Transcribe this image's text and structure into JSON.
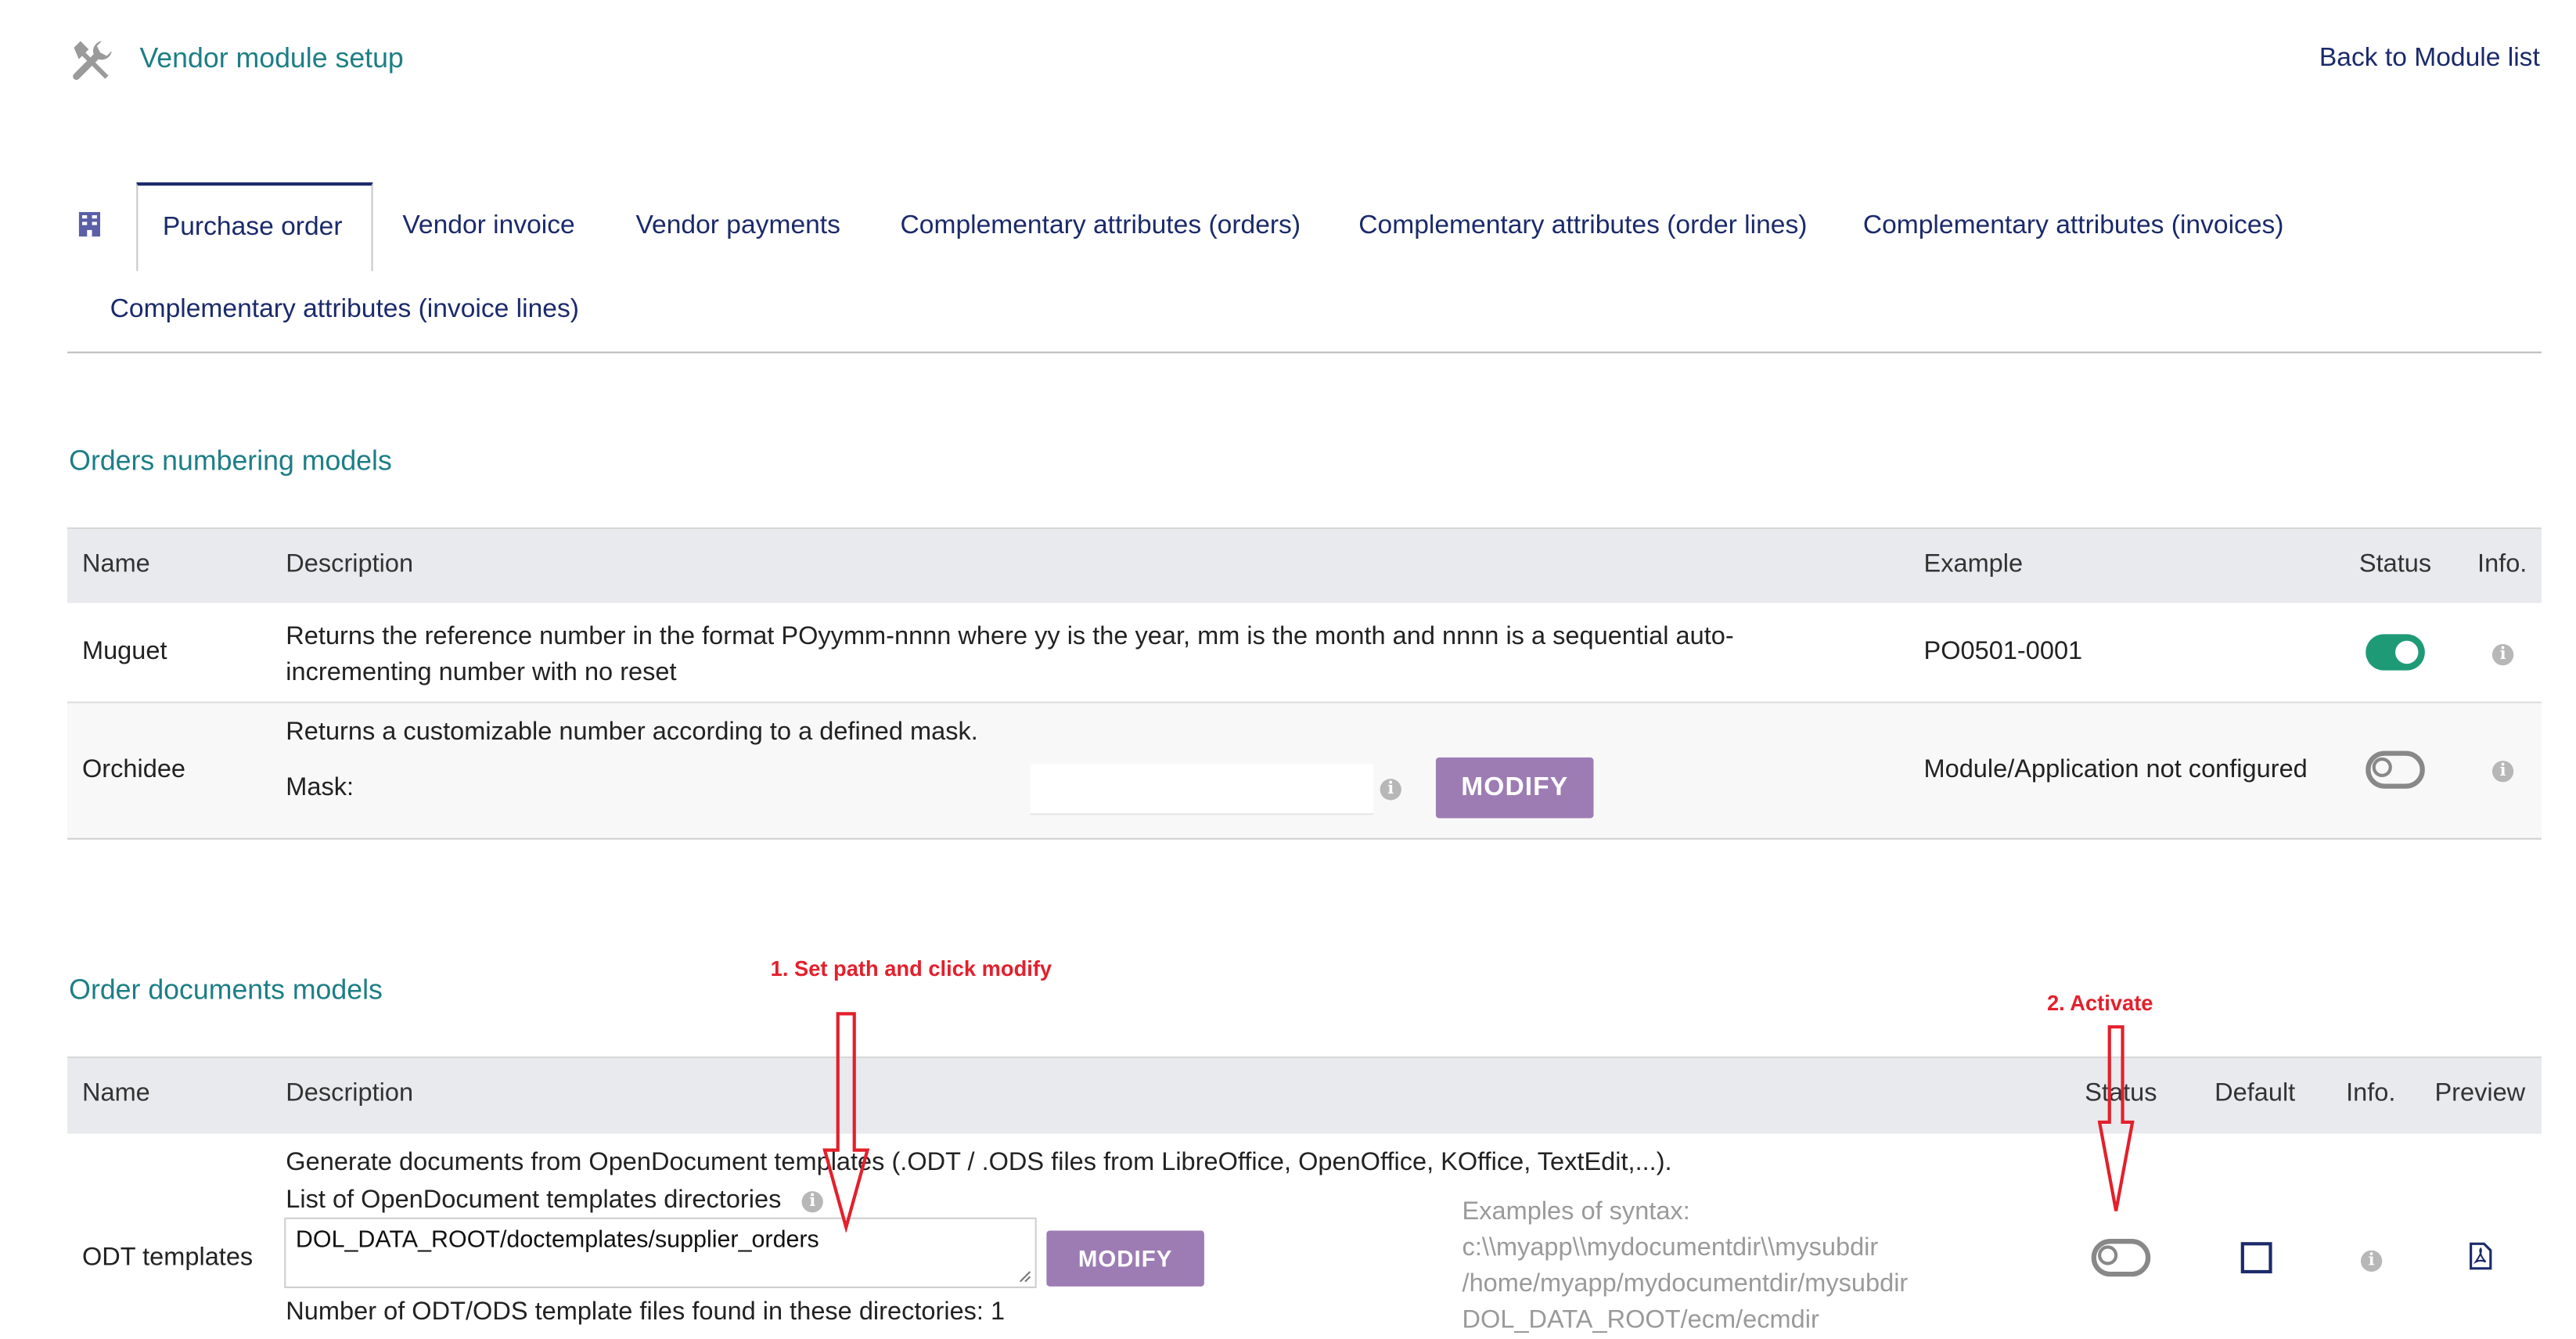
{
  "header": {
    "title": "Vendor module setup",
    "back_link": "Back to Module list"
  },
  "tabs": [
    {
      "label": "Purchase order",
      "active": true
    },
    {
      "label": "Vendor invoice"
    },
    {
      "label": "Vendor payments"
    },
    {
      "label": "Complementary attributes (orders)"
    },
    {
      "label": "Complementary attributes (order lines)"
    },
    {
      "label": "Complementary attributes (invoices)"
    },
    {
      "label": "Complementary attributes (invoice lines)"
    }
  ],
  "numbering": {
    "title": "Orders numbering models",
    "columns": {
      "name": "Name",
      "description": "Description",
      "example": "Example",
      "status": "Status",
      "info": "Info."
    },
    "rows": [
      {
        "name": "Muguet",
        "description": "Returns the reference number in the format POyymm-nnnn where yy is the year, mm is the month and nnnn is a sequential auto-incrementing number with no reset",
        "example": "PO0501-0001",
        "status": "on"
      },
      {
        "name": "Orchidee",
        "description": "Returns a customizable number according to a defined mask.",
        "mask_label": "Mask:",
        "mask_value": "",
        "modify_label": "MODIFY",
        "example": "Module/Application not configured",
        "status": "off"
      }
    ]
  },
  "documents": {
    "title": "Order documents models",
    "columns": {
      "name": "Name",
      "description": "Description",
      "status": "Status",
      "default": "Default",
      "info": "Info.",
      "preview": "Preview"
    },
    "rows": [
      {
        "name": "ODT templates",
        "description": "Generate documents from OpenDocument templates (.ODT / .ODS files from LibreOffice, OpenOffice, KOffice, TextEdit,...).",
        "dirs_label": "List of OpenDocument templates directories",
        "dirs_value": "DOL_DATA_ROOT/doctemplates/supplier_orders",
        "modify_label": "MODIFY",
        "syntax_title": "Examples of syntax:",
        "syntax_1": "c:\\\\myapp\\\\mydocumentdir\\\\mysubdir",
        "syntax_2": "/home/myapp/mydocumentdir/mysubdir",
        "syntax_3": "DOL_DATA_ROOT/ecm/ecmdir",
        "count_text": "Number of ODT/ODS template files found in these directories: 1",
        "status": "off",
        "default": false
      }
    ]
  },
  "annotations": {
    "step1": "1. Set path and click modify",
    "step2": "2. Activate"
  },
  "colors": {
    "accent_teal": "#1d7e86",
    "link_navy": "#1b2a6b",
    "button_purple": "#9d7cb4",
    "toggle_on": "#1f9a77",
    "annotation_red": "#e3202c"
  }
}
